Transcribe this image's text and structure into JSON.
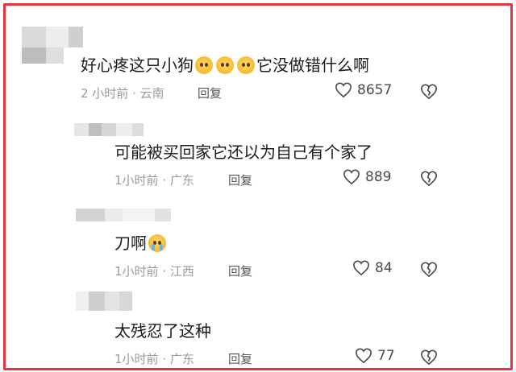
{
  "comments": [
    {
      "text_before": "好心疼这只小狗",
      "text_after": "它没做错什么啊",
      "emoji_names": [
        "pleading-face-icon",
        "pleading-face-icon",
        "pleading-face-icon"
      ],
      "time": "2 小时前 · 云南",
      "reply": "回复",
      "likes": "8657"
    },
    {
      "text_before": "可能被买回家它还以为自己有个家了",
      "text_after": "",
      "emoji_names": [],
      "time": "1小时前 · 广东",
      "reply": "回复",
      "likes": "889"
    },
    {
      "text_before": "刀啊",
      "text_after": "",
      "emoji_names": [
        "crying-face-icon"
      ],
      "time": "1小时前 · 江西",
      "reply": "回复",
      "likes": "84"
    },
    {
      "text_before": "太残忍了这种",
      "text_after": "",
      "emoji_names": [],
      "time": "1小时前 · 广东",
      "reply": "回复",
      "likes": "77"
    }
  ],
  "colors": {
    "frame_border": "#e5343d",
    "text": "#1c1c1c",
    "meta": "#9a9a9a"
  }
}
